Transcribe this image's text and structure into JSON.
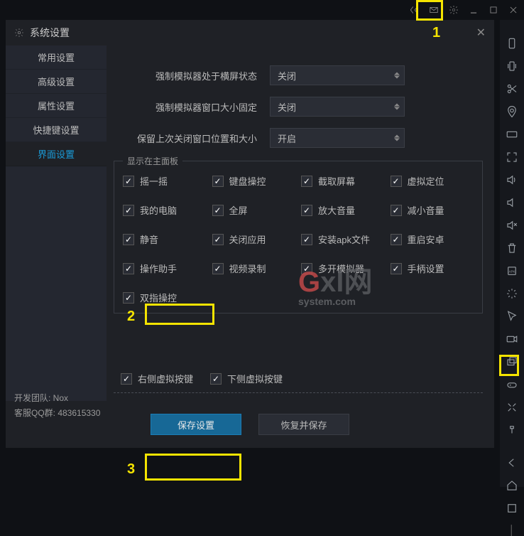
{
  "titlebar": {},
  "window": {
    "title": "系统设置"
  },
  "sidebar": {
    "items": [
      {
        "label": "常用设置"
      },
      {
        "label": "高级设置"
      },
      {
        "label": "属性设置"
      },
      {
        "label": "快捷键设置"
      },
      {
        "label": "界面设置"
      }
    ],
    "active_index": 4
  },
  "dropdowns": [
    {
      "label": "强制模拟器处于横屏状态",
      "value": "关闭"
    },
    {
      "label": "强制模拟器窗口大小固定",
      "value": "关闭"
    },
    {
      "label": "保留上次关闭窗口位置和大小",
      "value": "开启"
    }
  ],
  "panel": {
    "legend": "显示在主面板",
    "items": [
      {
        "label": "摇一摇",
        "checked": true
      },
      {
        "label": "键盘操控",
        "checked": true
      },
      {
        "label": "截取屏幕",
        "checked": true
      },
      {
        "label": "虚拟定位",
        "checked": true
      },
      {
        "label": "我的电脑",
        "checked": true
      },
      {
        "label": "全屏",
        "checked": true
      },
      {
        "label": "放大音量",
        "checked": true
      },
      {
        "label": "减小音量",
        "checked": true
      },
      {
        "label": "静音",
        "checked": true
      },
      {
        "label": "关闭应用",
        "checked": true
      },
      {
        "label": "安装apk文件",
        "checked": true
      },
      {
        "label": "重启安卓",
        "checked": true
      },
      {
        "label": "操作助手",
        "checked": true
      },
      {
        "label": "视频录制",
        "checked": true
      },
      {
        "label": "多开模拟器",
        "checked": true
      },
      {
        "label": "手柄设置",
        "checked": true
      },
      {
        "label": "双指操控",
        "checked": true
      }
    ]
  },
  "virtual_buttons": [
    {
      "label": "右侧虚拟按键",
      "checked": true
    },
    {
      "label": "下侧虚拟按键",
      "checked": true
    }
  ],
  "footer": {
    "team": "开发团队: Nox",
    "qq": "客服QQ群: 483615330"
  },
  "actions": {
    "save": "保存设置",
    "restore": "恢复并保存"
  },
  "annotations": {
    "n1": "1",
    "n2": "2",
    "n3": "3"
  },
  "watermark": {
    "big1": "G",
    "big2": "xl网",
    "sub": "system.com"
  }
}
